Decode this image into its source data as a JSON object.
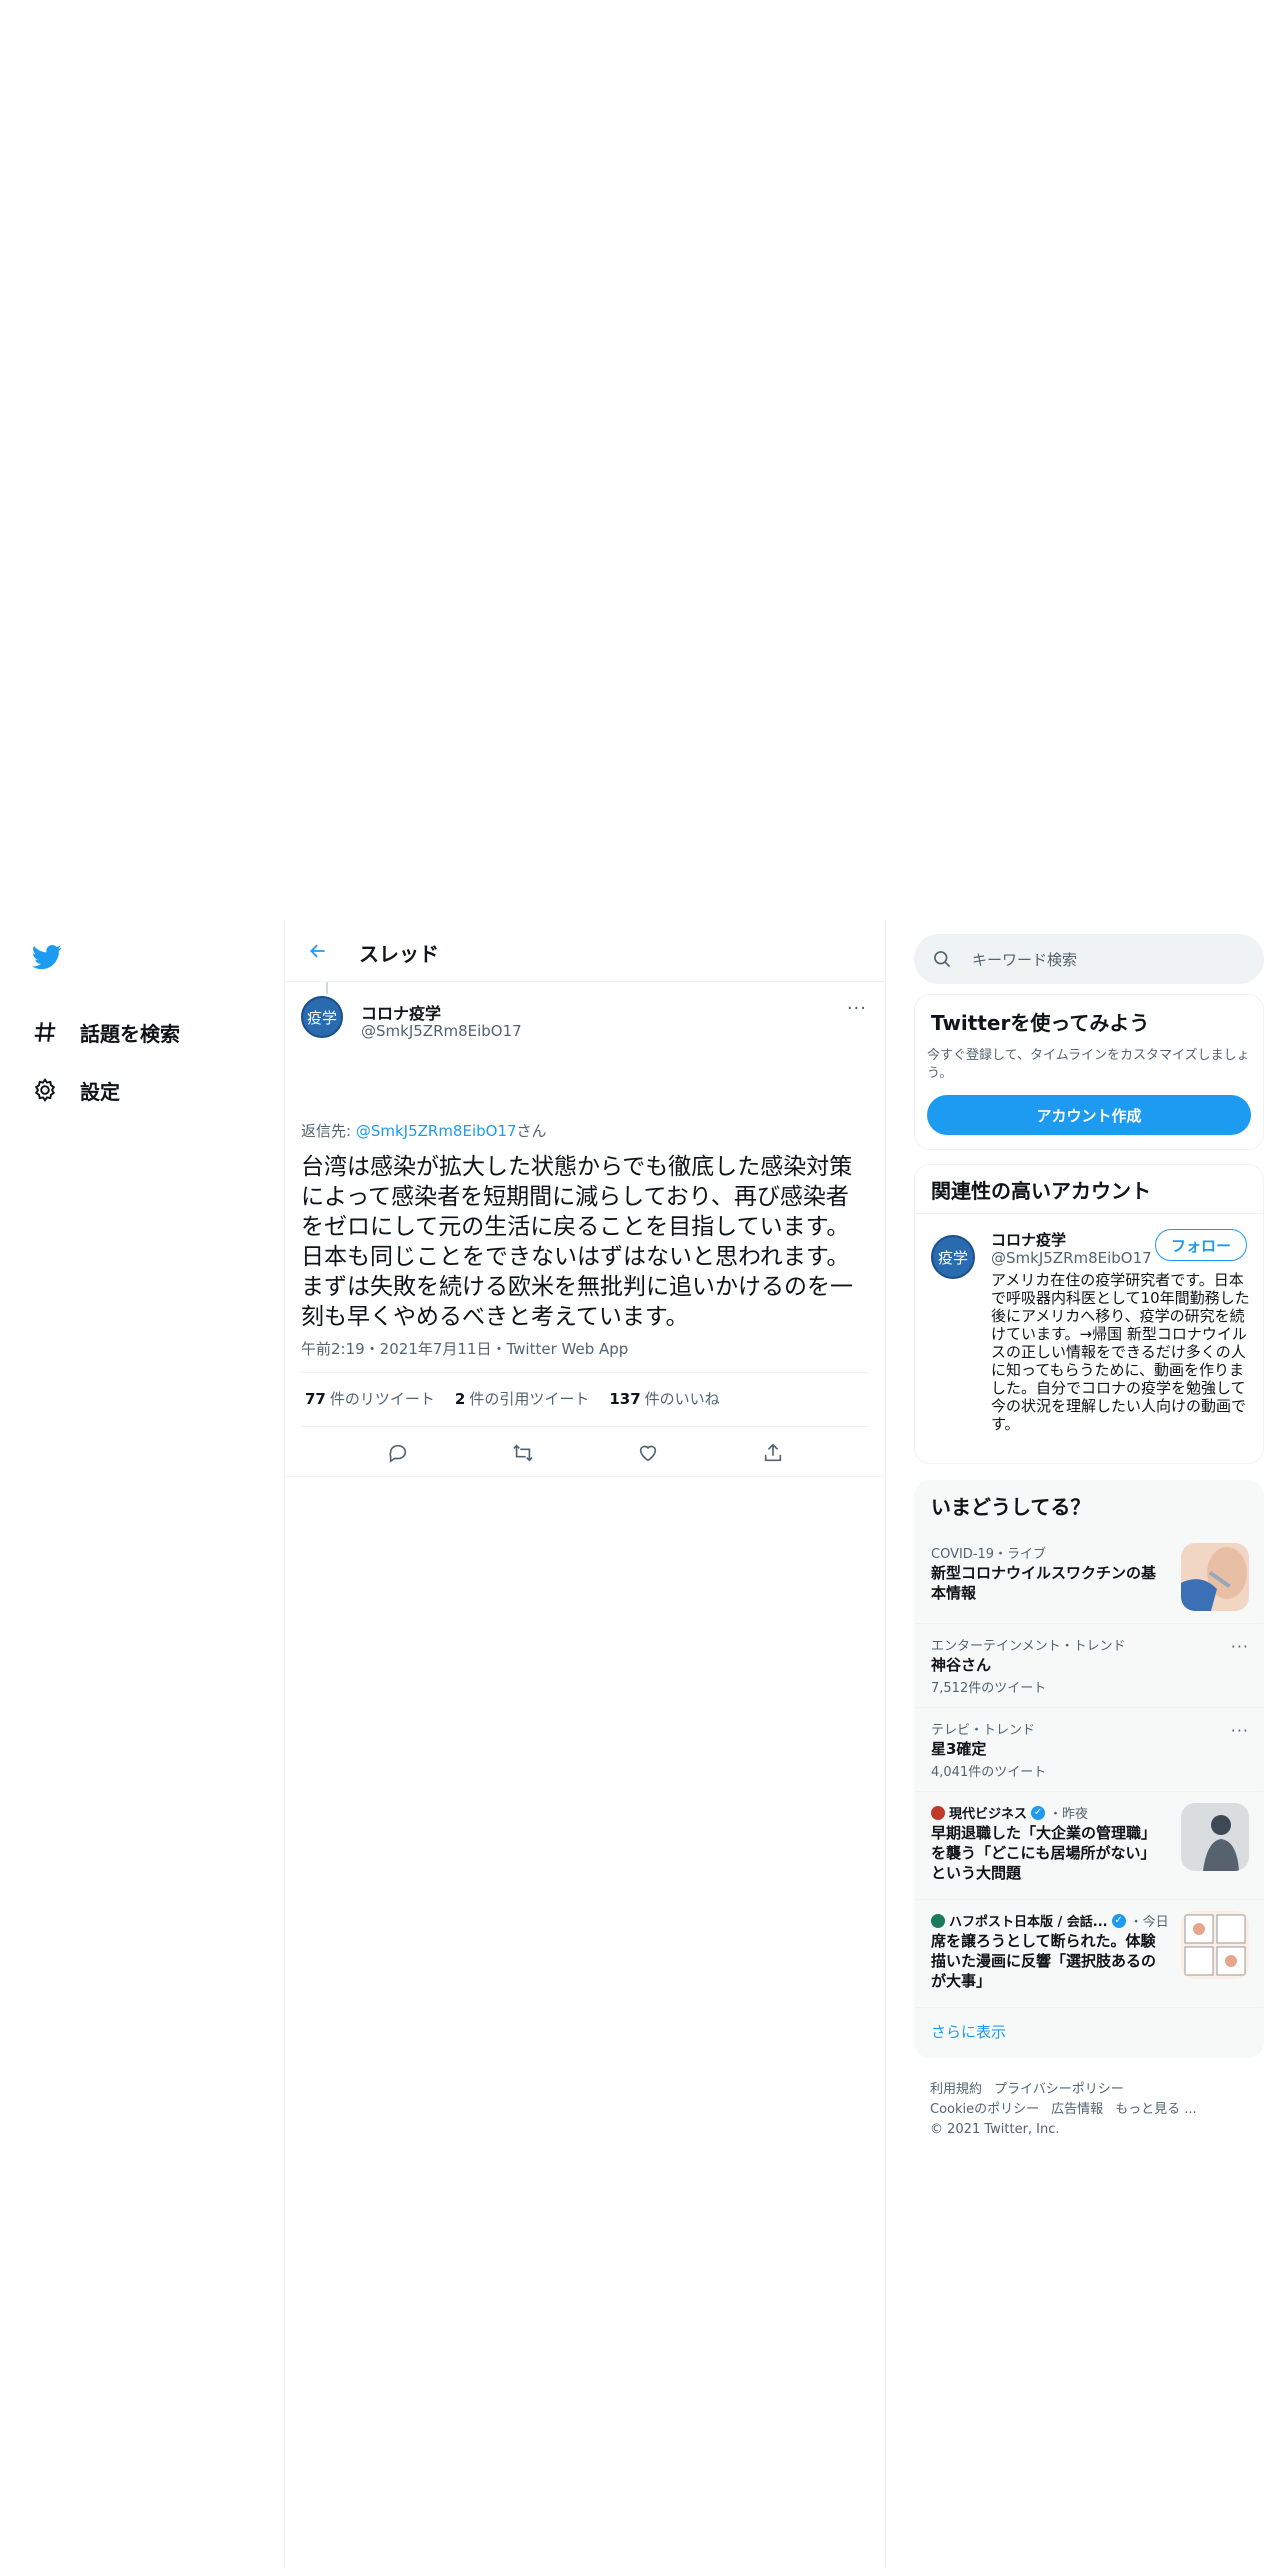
{
  "nav": {
    "items": [
      {
        "label": "話題を検索",
        "icon": "hashtag-icon"
      },
      {
        "label": "設定",
        "icon": "gear-icon"
      }
    ]
  },
  "header": {
    "title": "スレッド"
  },
  "tweet": {
    "avatar_text": "疫学",
    "author_name": "コロナ疫学",
    "author_handle": "@SmkJ5ZRm8EibO17",
    "more": "···",
    "reply_prefix": "返信先: ",
    "reply_mention": "@SmkJ5ZRm8EibO17",
    "reply_suffix": "さん",
    "text": "台湾は感染が拡大した状態からでも徹底した感染対策によって感染者を短期間に減らしており、再び感染者をゼロにして元の生活に戻ることを目指しています。日本も同じことをできないはずはないと思われます。まずは失敗を続ける欧米を無批判に追いかけるのを一刻も早くやめるべきと考えています。",
    "meta": "午前2:19・2021年7月11日・Twitter Web App",
    "stats": [
      {
        "count": "77",
        "label": "件のリツイート"
      },
      {
        "count": "2",
        "label": "件の引用ツイート"
      },
      {
        "count": "137",
        "label": "件のいいね"
      }
    ]
  },
  "search": {
    "placeholder": "キーワード検索"
  },
  "signup": {
    "title": "Twitterを使ってみよう",
    "desc": "今すぐ登録して、タイムラインをカスタマイズしましょう。",
    "button": "アカウント作成"
  },
  "relevant": {
    "title": "関連性の高いアカウント",
    "avatar_text": "疫学",
    "name": "コロナ疫学",
    "handle": "@SmkJ5ZRm8EibO17",
    "follow": "フォロー",
    "bio": "アメリカ在住の疫学研究者です。日本で呼吸器内科医として10年間勤務した後にアメリカへ移り、疫学の研究を続けています。→帰国 新型コロナウイルスの正しい情報をできるだけ多くの人に知ってもらうために、動画を作りました。自分でコロナの疫学を勉強して今の状況を理解したい人向けの動画です。"
  },
  "trends": {
    "title": "いまどうしてる？",
    "items": [
      {
        "meta": "COVID-19・ライブ",
        "title": "新型コロナウイルスワクチンの基本情報"
      },
      {
        "meta": "エンターテインメント・トレンド",
        "title": "神谷さん",
        "count": "7,512件のツイート"
      },
      {
        "meta": "テレビ・トレンド",
        "title": "星3確定",
        "count": "4,041件のツイート"
      },
      {
        "source": "現代ビジネス",
        "time": "・昨夜",
        "title": "早期退職した「大企業の管理職」を襲う「どこにも居場所がない」という大問題"
      },
      {
        "source": "ハフポスト日本版 / 会話...",
        "time": "・今日",
        "title": "席を譲ろうとして断られた。体験描いた漫画に反響「選択肢あるのが大事」"
      }
    ],
    "show_more": "さらに表示"
  },
  "footer": {
    "links": [
      "利用規約",
      "プライバシーポリシー",
      "Cookieのポリシー",
      "広告情報",
      "もっと見る ..."
    ],
    "copyright": "© 2021 Twitter, Inc."
  },
  "colors": {
    "accent": "#1d9bf0",
    "text": "#0f1419",
    "muted": "#536471",
    "border": "#eff3f4"
  }
}
